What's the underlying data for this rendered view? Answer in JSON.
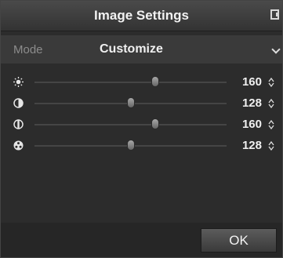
{
  "dialog": {
    "title": "Image Settings",
    "close_icon": "close-icon"
  },
  "mode": {
    "label": "Mode",
    "value": "Customize",
    "dropdown_icon": "chevron-down-icon"
  },
  "sliders": [
    {
      "name": "brightness",
      "icon": "sun-icon",
      "value": "160",
      "level": 0.63
    },
    {
      "name": "contrast",
      "icon": "contrast-icon",
      "value": "128",
      "level": 0.5
    },
    {
      "name": "saturation",
      "icon": "saturation-icon",
      "value": "160",
      "level": 0.63
    },
    {
      "name": "hue",
      "icon": "hue-icon",
      "value": "128",
      "level": 0.5
    }
  ],
  "footer": {
    "ok_label": "OK"
  }
}
